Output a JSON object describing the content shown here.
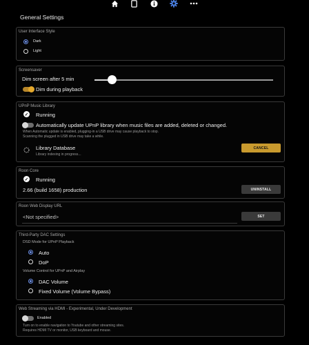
{
  "topbar": {
    "icons": [
      "home-icon",
      "tablet-icon",
      "info-icon",
      "gear-icon",
      "more-icon"
    ],
    "active_icon": "gear-icon",
    "accent": "#4a7fe0"
  },
  "page_title": "General Settings",
  "ui_style": {
    "title": "User Interface Style",
    "options": [
      "Dark",
      "Light"
    ],
    "selected": "Dark"
  },
  "screensaver": {
    "title": "Screensaver",
    "dim_label": "Dim screen after 5 min",
    "slider_level": 0.18,
    "dim_playback_label": "Dim during playback",
    "dim_playback_on": true
  },
  "upnp": {
    "title": "UPnP Music Library",
    "status": "Running",
    "auto_update_label": "Automatically update UPnP library when music files are added, deleted or changed.",
    "auto_update_on": false,
    "note1": "When Automatic update is enabled, plugging-in a USB drive may cause playback to stop.",
    "note2": "Scanning the plugged in USB drive may take a while.",
    "db_label": "Library Database",
    "db_status": "Library indexing in progress...",
    "cancel_label": "CANCEL"
  },
  "roon_core": {
    "title": "Roon Core",
    "status": "Running",
    "version": "2.66 (build 1658) production",
    "uninstall_label": "UNINSTALL"
  },
  "roon_web": {
    "title": "Roon Web Display URL",
    "value": "<Not specified>",
    "set_label": "SET"
  },
  "dac": {
    "title": "Third-Party DAC Settings",
    "dsd_label": "DSD Mode for UPnP Playback",
    "dsd_options": [
      "Auto",
      "DoP"
    ],
    "dsd_selected": "Auto",
    "volume_label": "Volume Control for UPnP and Airplay",
    "volume_options": [
      "DAC Volume",
      "Fixed Volume (Volume Bypass)"
    ],
    "volume_selected": "DAC Volume"
  },
  "web_streaming": {
    "title": "Web Streaming via HDMI - Experimental, Under Development",
    "toggle_label": "Enabled",
    "enabled": false,
    "note1": "Turn on to enable navigation to Youtube and other streaming sites.",
    "note2": "Requires HDMI TV or monitor, USB keyboard and mouse."
  },
  "colors": {
    "accent_blue": "#6c8fe6",
    "accent_gold": "#c99a2e",
    "background": "#000000"
  }
}
